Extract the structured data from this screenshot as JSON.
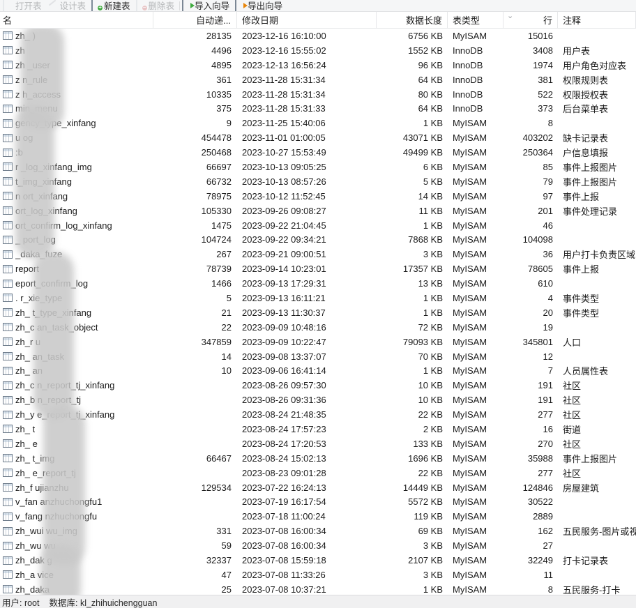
{
  "toolbar": {
    "items": [
      {
        "label": "打开表",
        "icon": "open-table-icon",
        "enabled": false
      },
      {
        "label": "设计表",
        "icon": "design-table-icon",
        "enabled": false
      },
      {
        "label": "新建表",
        "icon": "new-table-icon",
        "enabled": true
      },
      {
        "label": "删除表",
        "icon": "delete-table-icon",
        "enabled": false
      },
      {
        "label": "导入向导",
        "icon": "import-wizard-icon",
        "enabled": true
      },
      {
        "label": "导出向导",
        "icon": "export-wizard-icon",
        "enabled": true
      }
    ]
  },
  "columns": {
    "name": "名",
    "auto_increment": "自动递...",
    "modify_date": "修改日期",
    "data_length": "数据长度",
    "table_type": "表类型",
    "rows": "行",
    "comment": "注释"
  },
  "sort_indicator": "⌄",
  "rows": [
    {
      "name": "zh_                 )",
      "auto": "28135",
      "date": "2023-12-16 16:10:00",
      "len": "6756 KB",
      "type": "MyISAM",
      "rowcount": "15016",
      "note": ""
    },
    {
      "name": "zh",
      "auto": "4496",
      "date": "2023-12-16 15:55:02",
      "len": "1552 KB",
      "type": "InnoDB",
      "rowcount": "3408",
      "note": "用户表"
    },
    {
      "name": "zh          _user",
      "auto": "4895",
      "date": "2023-12-13 16:56:24",
      "len": "96 KB",
      "type": "InnoDB",
      "rowcount": "1974",
      "note": "用户角色对应表"
    },
    {
      "name": "z        n_rule",
      "auto": "361",
      "date": "2023-11-28 15:31:34",
      "len": "64 KB",
      "type": "InnoDB",
      "rowcount": "381",
      "note": "权限规则表"
    },
    {
      "name": "z       h_access",
      "auto": "10335",
      "date": "2023-11-28 15:31:34",
      "len": "80 KB",
      "type": "InnoDB",
      "rowcount": "522",
      "note": "权限授权表"
    },
    {
      "name": "       min_menu",
      "auto": "375",
      "date": "2023-11-28 15:31:33",
      "len": "64 KB",
      "type": "InnoDB",
      "rowcount": "373",
      "note": "后台菜单表"
    },
    {
      "name": "      gency_type_xinfang",
      "auto": "9",
      "date": "2023-11-25 15:40:06",
      "len": "1 KB",
      "type": "MyISAM",
      "rowcount": "8",
      "note": ""
    },
    {
      "name": "  u      og",
      "auto": "454478",
      "date": "2023-11-01 01:00:05",
      "len": "43071 KB",
      "type": "MyISAM",
      "rowcount": "403202",
      "note": "缺卡记录表"
    },
    {
      "name": "     :b",
      "auto": "250468",
      "date": "2023-10-27 15:53:49",
      "len": "49499 KB",
      "type": "MyISAM",
      "rowcount": "250364",
      "note": "户信息填报"
    },
    {
      "name": "  r        _log_xinfang_img",
      "auto": "66697",
      "date": "2023-10-13 09:05:25",
      "len": "6 KB",
      "type": "MyISAM",
      "rowcount": "85",
      "note": "事件上报图片"
    },
    {
      "name": "        t_img_xinfang",
      "auto": "66732",
      "date": "2023-10-13 08:57:26",
      "len": "5 KB",
      "type": "MyISAM",
      "rowcount": "79",
      "note": "事件上报图片"
    },
    {
      "name": " n      ort_xinfang",
      "auto": "78975",
      "date": "2023-10-12 11:52:45",
      "len": "14 KB",
      "type": "MyISAM",
      "rowcount": "97",
      "note": "事件上报"
    },
    {
      "name": "       ort_log_xinfang",
      "auto": "105330",
      "date": "2023-09-26 09:08:27",
      "len": "11 KB",
      "type": "MyISAM",
      "rowcount": "201",
      "note": "事件处理记录"
    },
    {
      "name": "        ort_confirm_log_xinfang",
      "auto": "1475",
      "date": "2023-09-22 21:04:45",
      "len": "1 KB",
      "type": "MyISAM",
      "rowcount": "46",
      "note": ""
    },
    {
      "name": "   _ port_log",
      "auto": "104724",
      "date": "2023-09-22 09:34:21",
      "len": "7868 KB",
      "type": "MyISAM",
      "rowcount": "104098",
      "note": ""
    },
    {
      "name": "    _daka_fuze",
      "auto": "267",
      "date": "2023-09-21 09:00:51",
      "len": "3 KB",
      "type": "MyISAM",
      "rowcount": "36",
      "note": "用户打卡负责区域"
    },
    {
      "name": "    report",
      "auto": "78739",
      "date": "2023-09-14 10:23:01",
      "len": "17357 KB",
      "type": "MyISAM",
      "rowcount": "78605",
      "note": "事件上报"
    },
    {
      "name": "     eport_confirm_log",
      "auto": "1466",
      "date": "2023-09-13 17:29:31",
      "len": "13 KB",
      "type": "MyISAM",
      "rowcount": "610",
      "note": ""
    },
    {
      "name": ".       r_xie_type",
      "auto": "5",
      "date": "2023-09-13 16:11:21",
      "len": "1 KB",
      "type": "MyISAM",
      "rowcount": "4",
      "note": "事件类型"
    },
    {
      "name": "zh_       t_type_xinfang",
      "auto": "21",
      "date": "2023-09-13 11:30:37",
      "len": "1 KB",
      "type": "MyISAM",
      "rowcount": "20",
      "note": "事件类型"
    },
    {
      "name": "zh_c      an_task_object",
      "auto": "22",
      "date": "2023-09-09 10:48:16",
      "len": "72 KB",
      "type": "MyISAM",
      "rowcount": "19",
      "note": ""
    },
    {
      "name": "zh_r      u",
      "auto": "347859",
      "date": "2023-09-09 10:22:47",
      "len": "79093 KB",
      "type": "MyISAM",
      "rowcount": "345801",
      "note": "人口"
    },
    {
      "name": "zh_       an_task",
      "auto": "14",
      "date": "2023-09-08 13:37:07",
      "len": "70 KB",
      "type": "MyISAM",
      "rowcount": "12",
      "note": ""
    },
    {
      "name": "zh_      an",
      "auto": "10",
      "date": "2023-09-06 16:41:14",
      "len": "1 KB",
      "type": "MyISAM",
      "rowcount": "7",
      "note": "人员属性表"
    },
    {
      "name": "zh_c     n_report_tj_xinfang",
      "auto": "",
      "date": "2023-08-26 09:57:30",
      "len": "10 KB",
      "type": "MyISAM",
      "rowcount": "191",
      "note": "社区"
    },
    {
      "name": "zh_b     n_report_tj",
      "auto": "",
      "date": "2023-08-26 09:31:36",
      "len": "10 KB",
      "type": "MyISAM",
      "rowcount": "191",
      "note": "社区"
    },
    {
      "name": "zh_y     e_report_tj_xinfang",
      "auto": "",
      "date": "2023-08-24 21:48:35",
      "len": "22 KB",
      "type": "MyISAM",
      "rowcount": "277",
      "note": "社区"
    },
    {
      "name": "zh_      t",
      "auto": "",
      "date": "2023-08-24 17:57:23",
      "len": "2 KB",
      "type": "MyISAM",
      "rowcount": "16",
      "note": "街道"
    },
    {
      "name": "zh_      e",
      "auto": "",
      "date": "2023-08-24 17:20:53",
      "len": "133 KB",
      "type": "MyISAM",
      "rowcount": "270",
      "note": "社区"
    },
    {
      "name": "zh_      t_img",
      "auto": "66467",
      "date": "2023-08-24 15:02:13",
      "len": "1696 KB",
      "type": "MyISAM",
      "rowcount": "35988",
      "note": "事件上报图片"
    },
    {
      "name": "zh_      e_report_tj",
      "auto": "",
      "date": "2023-08-23 09:01:28",
      "len": "22 KB",
      "type": "MyISAM",
      "rowcount": "277",
      "note": "社区"
    },
    {
      "name": "zh_f      ujianzhu",
      "auto": "129534",
      "date": "2023-07-22 16:24:13",
      "len": "14449 KB",
      "type": "MyISAM",
      "rowcount": "124846",
      "note": "房屋建筑"
    },
    {
      "name": "v_fan     anzhuchongfu1",
      "auto": "",
      "date": "2023-07-19 16:17:54",
      "len": "5572 KB",
      "type": "MyISAM",
      "rowcount": "30522",
      "note": ""
    },
    {
      "name": "v_fang     nzhuchongfu",
      "auto": "",
      "date": "2023-07-18 11:00:24",
      "len": "119 KB",
      "type": "MyISAM",
      "rowcount": "2889",
      "note": ""
    },
    {
      "name": "zh_wui      wu_img",
      "auto": "331",
      "date": "2023-07-08 16:00:34",
      "len": "69 KB",
      "type": "MyISAM",
      "rowcount": "162",
      "note": "五民服务-图片或视频"
    },
    {
      "name": "zh_wu       wu",
      "auto": "59",
      "date": "2023-07-08 16:00:34",
      "len": "3 KB",
      "type": "MyISAM",
      "rowcount": "27",
      "note": ""
    },
    {
      "name": "zh_dak      g",
      "auto": "32337",
      "date": "2023-07-08 15:59:18",
      "len": "2107 KB",
      "type": "MyISAM",
      "rowcount": "32249",
      "note": "打卡记录表"
    },
    {
      "name": "zh_a       vice",
      "auto": "47",
      "date": "2023-07-08 11:33:26",
      "len": "3 KB",
      "type": "MyISAM",
      "rowcount": "11",
      "note": ""
    },
    {
      "name": "zh_daka",
      "auto": "25",
      "date": "2023-07-08 10:37:21",
      "len": "1 KB",
      "type": "MyISAM",
      "rowcount": "8",
      "note": "五民服务-打卡"
    }
  ],
  "statusbar": {
    "user_label": "用户: root",
    "database_label": "数据库: kl_zhihuichengguan"
  }
}
